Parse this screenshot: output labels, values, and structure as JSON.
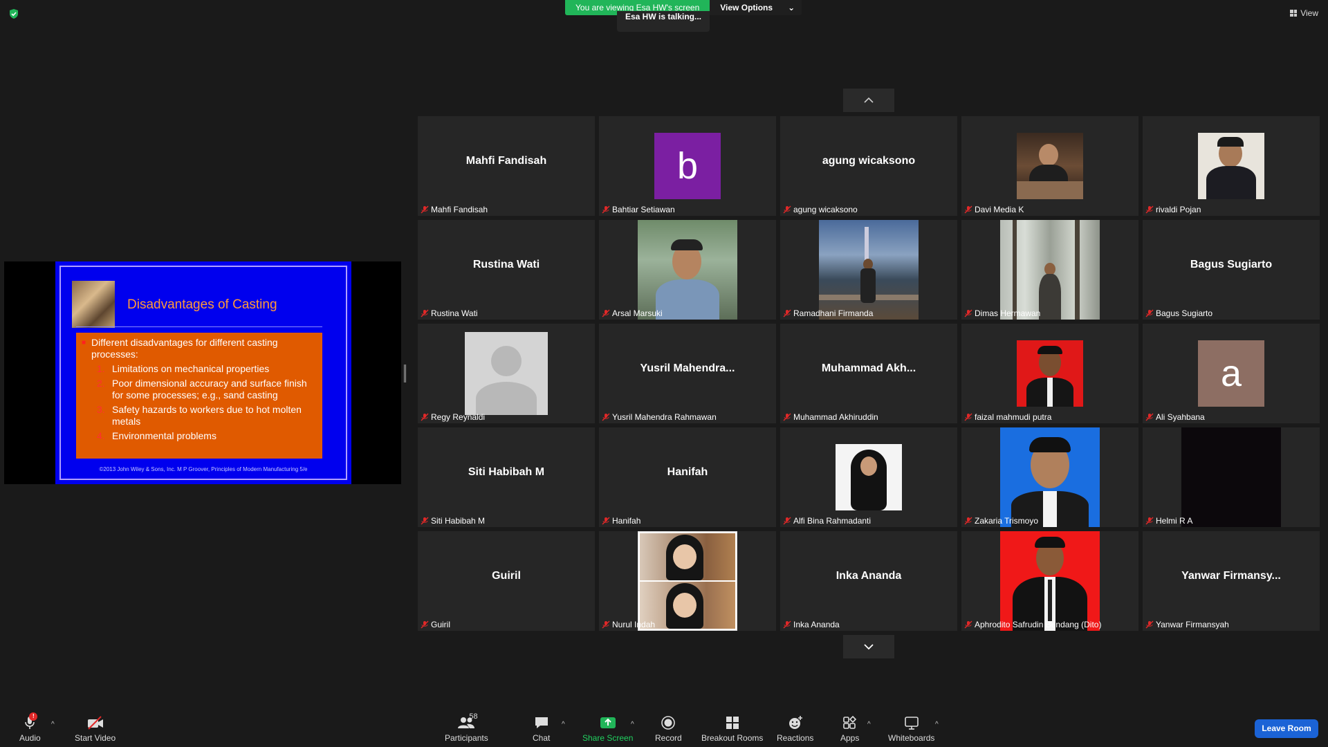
{
  "banner": {
    "viewing": "You are viewing Esa HW's screen",
    "options": "View Options"
  },
  "talking": "Esa HW is talking...",
  "view_label": "View",
  "slide": {
    "title": "Disadvantages of Casting",
    "intro": "Different disadvantages for different casting processes:",
    "items": [
      {
        "num": "1.",
        "text": "Limitations on mechanical properties"
      },
      {
        "num": "2.",
        "text": "Poor dimensional accuracy and surface finish for some processes; e.g., sand casting"
      },
      {
        "num": "3.",
        "text": "Safety hazards to workers due to hot molten metals"
      },
      {
        "num": "4.",
        "text": "Environmental problems"
      }
    ],
    "footer": "©2013 John Wiley & Sons, Inc.  M P Groover, Principles of Modern Manufacturing 5/e"
  },
  "participants": [
    {
      "label": "Mahfi Fandisah",
      "big": "Mahfi Fandisah"
    },
    {
      "label": "Bahtiar Setiawan",
      "letter": "b",
      "color": "#7b1fa2"
    },
    {
      "label": "agung wicaksono",
      "big": "agung wicaksono"
    },
    {
      "label": "Davi Media K",
      "photo": "cafe"
    },
    {
      "label": "rivaldi Pojan",
      "photo": "rivaldi"
    },
    {
      "label": "Rustina Wati",
      "big": "Rustina Wati"
    },
    {
      "label": "Arsal Marsuki",
      "photo": "park"
    },
    {
      "label": "Ramadhani Firmanda",
      "photo": "city"
    },
    {
      "label": "Dimas Hermawan",
      "photo": "forest"
    },
    {
      "label": "Bagus Sugiarto",
      "big": "Bagus Sugiarto"
    },
    {
      "label": "Regy Reynaldi",
      "photo": "default"
    },
    {
      "label": "Yusril Mahendra Rahmawan",
      "big": "Yusril  Mahendra..."
    },
    {
      "label": "Muhammad Akhiruddin",
      "big": "Muhammad  Akh..."
    },
    {
      "label": "faizal mahmudi putra",
      "photo": "redsuit"
    },
    {
      "label": "Ali Syahbana",
      "letter": "a",
      "color": "#8d6e63"
    },
    {
      "label": "Siti Habibah M",
      "big": "Siti Habibah M"
    },
    {
      "label": "Hanifah",
      "big": "Hanifah"
    },
    {
      "label": "Alfi Bina Rahmadanti",
      "photo": "hijab"
    },
    {
      "label": "Zakaria Trismoyo",
      "photo": "bluesuit"
    },
    {
      "label": "Helmi R A",
      "photo": "dark"
    },
    {
      "label": "Guiril",
      "big": "Guiril"
    },
    {
      "label": "Nurul Indah",
      "photo": "nurul"
    },
    {
      "label": "Inka Ananda",
      "big": "Inka Ananda"
    },
    {
      "label": "Aphrodito Safrudin Bendang (Dito)",
      "photo": "redsuit2"
    },
    {
      "label": "Yanwar Firmansyah",
      "big": "Yanwar  Firmansy..."
    }
  ],
  "toolbar": {
    "audio": "Audio",
    "audio_badge": "!",
    "start_video": "Start Video",
    "participants": "Participants",
    "participants_count": "58",
    "chat": "Chat",
    "share_screen": "Share Screen",
    "record": "Record",
    "breakout_rooms": "Breakout Rooms",
    "reactions": "Reactions",
    "apps": "Apps",
    "whiteboards": "Whiteboards",
    "leave": "Leave Room"
  },
  "colors": {
    "share_green": "#21b559",
    "leave_blue": "#1b63d6",
    "tile_bg": "#262626"
  }
}
